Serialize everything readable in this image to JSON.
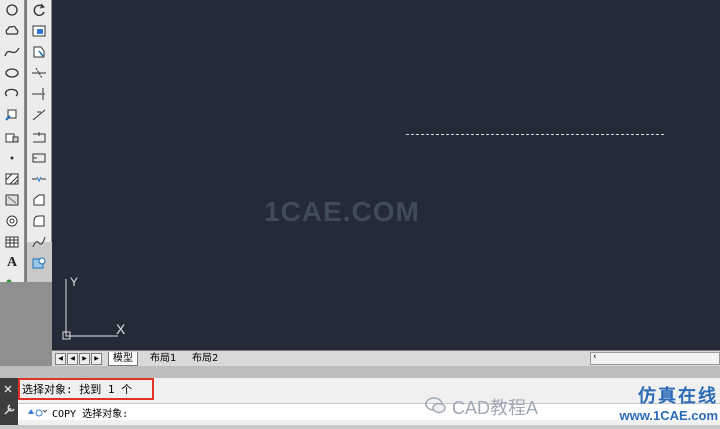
{
  "toolbar_left": {
    "icons": [
      "circle-icon",
      "cloud-icon",
      "spline-icon",
      "ellipse-icon",
      "ellipse-arc-icon",
      "insert-block-icon",
      "make-block-icon",
      "point-icon",
      "hatch-icon",
      "gradient-icon",
      "region-icon",
      "table-icon",
      "multiline-text-icon",
      "add-selected-icon"
    ],
    "text_label": "A"
  },
  "toolbar_modify": {
    "icons": [
      "rotate-icon",
      "scale-icon",
      "stretch-icon",
      "trim-icon",
      "extend-icon",
      "break-at-point-icon",
      "break-icon",
      "join-icon",
      "chamfer-icon",
      "fillet-icon",
      "blend-curves-icon",
      "explode-icon"
    ]
  },
  "canvas": {
    "watermark": "1CAE.COM",
    "ucs_y": "Y",
    "ucs_x": "X"
  },
  "layout_tabs": {
    "tabs": [
      "模型",
      "布局1",
      "布局2"
    ]
  },
  "command": {
    "history": "选择对象: 找到 1 个",
    "prompt": "COPY 选择对象:"
  },
  "watermarks": {
    "wechat": "CAD教程A",
    "site_cn": "仿真在线",
    "site_url": "www.1CAE.com"
  }
}
